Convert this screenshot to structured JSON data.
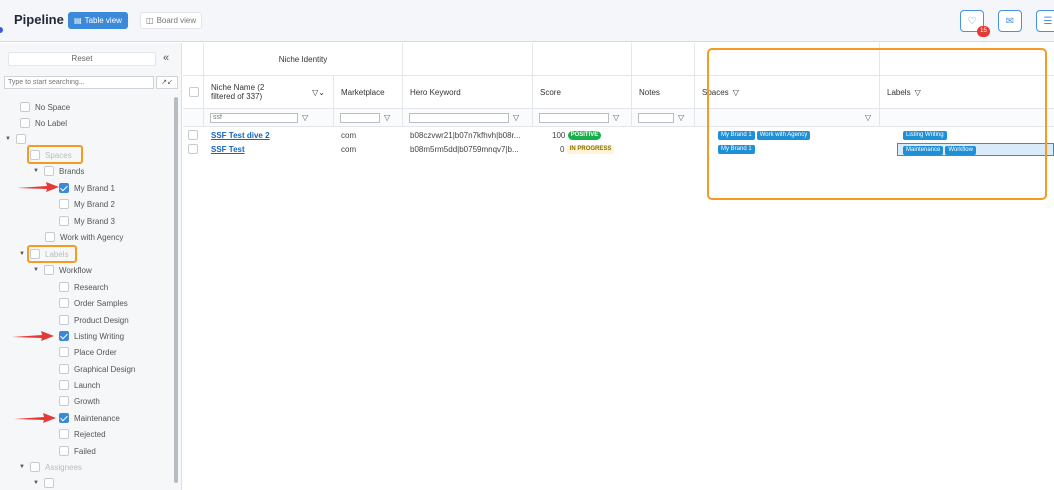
{
  "header": {
    "title": "Pipeline",
    "table_view_label": "Table view",
    "board_view_label": "Board view",
    "notification_count": "15"
  },
  "sidebar": {
    "reset_label": "Reset",
    "search_placeholder": "Type to start searching...",
    "no_space": "No Space",
    "no_label": "No Label",
    "spaces": "Spaces",
    "brands": "Brands",
    "my_brand_1": "My Brand 1",
    "my_brand_2": "My Brand 2",
    "my_brand_3": "My Brand 3",
    "work_with_agency": "Work with Agency",
    "labels": "Labels",
    "workflow": "Workflow",
    "research": "Research",
    "order_samples": "Order Samples",
    "product_design": "Product Design",
    "listing_writing": "Listing Writing",
    "place_order": "Place Order",
    "graphical_design": "Graphical Design",
    "launch": "Launch",
    "growth": "Growth",
    "maintenance": "Maintenance",
    "rejected": "Rejected",
    "failed": "Failed",
    "assignees": "Assignees"
  },
  "table": {
    "group_header": "Niche Identity",
    "col_niche": "Niche Name (2 filtered of 337)",
    "col_marketplace": "Marketplace",
    "col_hero": "Hero Keyword",
    "col_score": "Score",
    "col_notes": "Notes",
    "col_spaces": "Spaces",
    "col_labels": "Labels",
    "niche_filter": "ssf",
    "rows": [
      {
        "niche": "SSF Test dive 2",
        "marketplace": "com",
        "hero": "b08czvwr21|b07n7kfhvh|b08r...",
        "score": "100",
        "status": "POSITIVE",
        "spaces": [
          "My Brand 1",
          "Work with Agency"
        ],
        "labels": [
          "Listing Writing"
        ]
      },
      {
        "niche": "SSF Test",
        "marketplace": "com",
        "hero": "b08m5rm5dd|b0759mnqv7|b...",
        "score": "0",
        "status": "IN PROGRESS",
        "spaces": [
          "My Brand 1"
        ],
        "labels": [
          "Maintenance",
          "Workflow"
        ]
      }
    ]
  },
  "colors": {
    "accent": "#3b8ad9",
    "highlight": "#f59a23",
    "arrow": "#e53935",
    "tag": "#1f8fd6",
    "positive": "#18b04a"
  }
}
